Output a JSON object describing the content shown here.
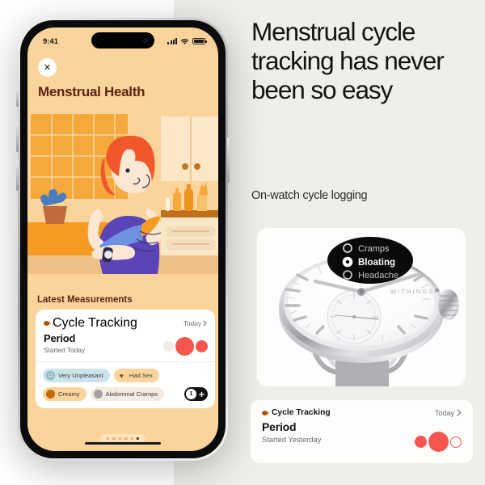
{
  "colors": {
    "page_left_bg": "#ffffff",
    "page_right_bg": "#f0eeea",
    "phone_screen_bg": "#fbd49c",
    "brand_brown": "#5c2411",
    "cycle_dot": "#b2540a",
    "flow_red": "#f7554f",
    "card_white": "#ffffff"
  },
  "phone": {
    "status_bar": {
      "time": "9:41",
      "cellular_icon": "signal-bars-icon",
      "wifi_icon": "wifi-icon",
      "battery_icon": "battery-icon"
    },
    "close_button": {
      "icon": "close-icon",
      "glyph": "✕"
    },
    "app_title": "Menstrual Health",
    "illustration_alt": "woman-reading-book-illustration",
    "section_label": "Latest Measurements",
    "measurement_card": {
      "category": "Cycle Tracking",
      "category_dot_icon": "cycle-tracking-dot-icon",
      "date_link": "Today",
      "chevron_icon": "chevron-right-icon",
      "title": "Period",
      "subtitle": "Started Today",
      "flow_dots": [
        {
          "name": "flow-dot-pale",
          "size": "small",
          "state": "empty"
        },
        {
          "name": "flow-dot-heavy",
          "size": "large",
          "state": "filled"
        },
        {
          "name": "flow-dot-medium",
          "size": "medium",
          "state": "filled"
        }
      ],
      "chips": [
        {
          "label": "Very Unpleasant",
          "icon": "frowning-face-icon",
          "glyph": "☹",
          "type": "mood"
        },
        {
          "label": "Had Sex",
          "icon": "heart-icon",
          "glyph": "♥",
          "type": "activity"
        },
        {
          "label": "Creamy",
          "icon": "discharge-dot-icon",
          "glyph": "",
          "type": "discharge"
        },
        {
          "label": "Abdominal Cramps",
          "icon": "symptom-dot-icon",
          "glyph": "",
          "type": "symptom"
        }
      ],
      "counter": {
        "value": "1",
        "add_icon": "plus-icon",
        "add_glyph": "+"
      }
    },
    "page_dots": {
      "total": 6,
      "active_index": 5
    },
    "home_indicator": "home-indicator"
  },
  "marketing": {
    "headline": "Menstrual cycle tracking has never been so easy",
    "subhead": "On-watch cycle logging"
  },
  "watch": {
    "brand": "WITHINGS",
    "screen_options": [
      {
        "label": "Cramps",
        "selected": false
      },
      {
        "label": "Bloating",
        "selected": true
      },
      {
        "label": "Headache",
        "selected": false
      }
    ]
  },
  "bottom_card": {
    "category": "Cycle Tracking",
    "category_dot_icon": "cycle-tracking-dot-icon",
    "date_link": "Today",
    "chevron_icon": "chevron-right-icon",
    "title": "Period",
    "subtitle": "Started Yesterday",
    "flow_dots": [
      {
        "name": "flow-dot-medium",
        "size": "medium",
        "state": "filled"
      },
      {
        "name": "flow-dot-heavy",
        "size": "large",
        "state": "filled"
      },
      {
        "name": "flow-dot-outline",
        "size": "small",
        "state": "outline"
      }
    ]
  }
}
